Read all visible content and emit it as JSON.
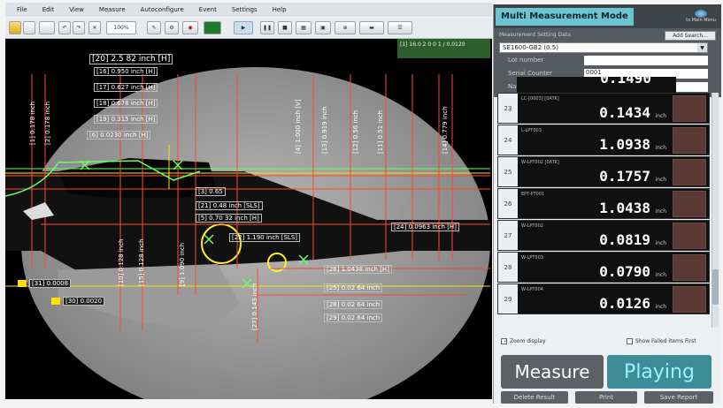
{
  "menu": {
    "items": [
      "File",
      "Edit",
      "View",
      "Measure",
      "Autoconfigure",
      "Event",
      "Settings",
      "Help"
    ]
  },
  "toolbar": {
    "zoom": "100%"
  },
  "overlay": {
    "top_left_labels": [
      "[20] 2.5 82 inch [H]",
      "[16] 0.950 inch [H]",
      "[17] 0.627 inch [H]",
      "[18] 0.678 inch [H]",
      "[19] 0.315 inch [H]",
      "[6] 0.0230 inch [H]"
    ],
    "vertical_labels": [
      "[1] 0.178 inch",
      "[2] 0.178 inch",
      "[4] 1.000 inch [V]",
      "[13] 0.919 inch",
      "[12] 0.56 inch",
      "[11] 0.51 inch",
      "[14] 0.779 inch",
      "[10] 0.128 inch",
      "[15] 0.128 inch",
      "[9] 1.090 inch",
      "[27] 0.143 inch"
    ],
    "center_labels": [
      "[3] 0.65",
      "[21] 0.48 inch [SLS]",
      "[5] 0.70 32 inch [H]",
      "[22] 1.190 inch [SLS]",
      "[26] 1.0438 inch [H]",
      "[25] 0.02 64 inch",
      "[28] 0.02 64 inch",
      "[29] 0.02 64 inch"
    ],
    "right_label": "[24] 0.0963 inch [H]",
    "side_labels": [
      "[31] 0.0008",
      "[30] 0.0020"
    ],
    "readout": "[1] 16.0 2 0 0 1 / 0.0120"
  },
  "panel": {
    "title": "Multi Measurement Mode",
    "back_label": "to Main Menu",
    "setting_title": "Measurement Setting Data",
    "setting_button": "Add Search...",
    "setting_value": "SE1600-GB2 (0.5)",
    "fields": [
      {
        "label": "Lot number",
        "value": ""
      },
      {
        "label": "Serial Counter",
        "value": "0001"
      },
      {
        "label": "Name",
        "value": ""
      }
    ],
    "top_partial_value": "0.1490",
    "rows": [
      {
        "num": "23",
        "label": "LC-[0003] [0ATK]",
        "value": "0.1434",
        "unit": "inch"
      },
      {
        "num": "24",
        "label": "L-LPT003",
        "value": "1.0938",
        "unit": "inch"
      },
      {
        "num": "25",
        "label": "W-LPT002 [0ATK]",
        "value": "0.1757",
        "unit": "inch"
      },
      {
        "num": "26",
        "label": "EPT-PT001",
        "value": "1.0438",
        "unit": "inch"
      },
      {
        "num": "27",
        "label": "W-LPT002",
        "value": "0.0819",
        "unit": "inch"
      },
      {
        "num": "28",
        "label": "W-LPT003",
        "value": "0.0790",
        "unit": "inch"
      },
      {
        "num": "29",
        "label": "W-LPT004",
        "value": "0.0126",
        "unit": "inch"
      }
    ],
    "zoom_display": "Zoom display",
    "show_failed": "Show Failed items First",
    "measure_label": "Measure",
    "playing_label": "Playing",
    "buttons": [
      "Delete Result",
      "Print",
      "Save Report"
    ],
    "colors": {
      "accent": "#6bc5d2",
      "playing_bg": "#3d8d99",
      "measure_bg": "#5d6166"
    }
  }
}
